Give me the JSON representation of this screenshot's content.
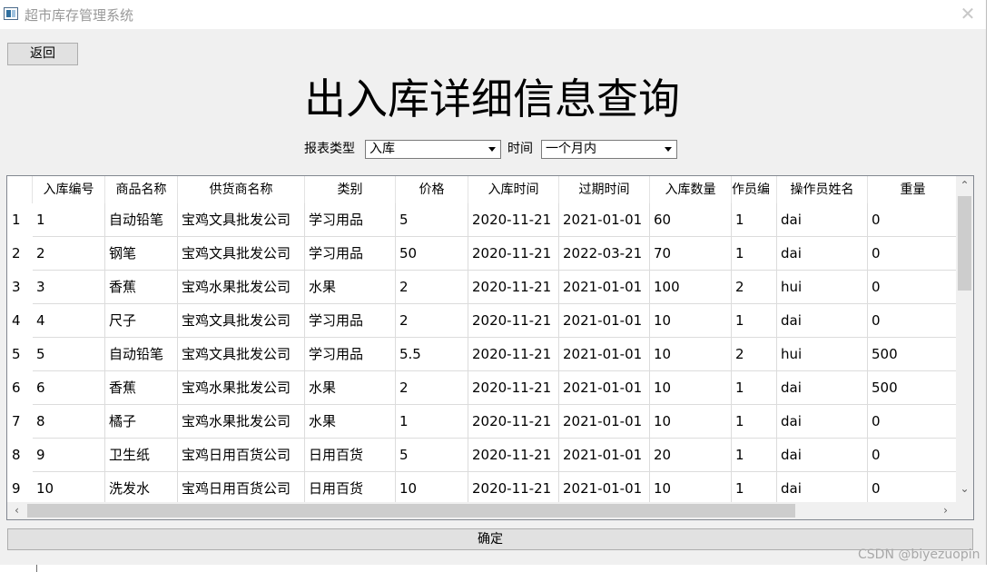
{
  "window": {
    "title": "超市库存管理系统",
    "close_glyph": "✕"
  },
  "back_label": "返回",
  "page_title": "出入库详细信息查询",
  "filters": {
    "report_type_label": "报表类型",
    "report_type_value": "入库",
    "time_label": "时间",
    "time_value": "一个月内"
  },
  "table": {
    "columns": [
      "入库编号",
      "商品名称",
      "供货商名称",
      "类别",
      "价格",
      "入库时间",
      "过期时间",
      "入库数量",
      "作员编",
      "操作员姓名",
      "重量"
    ],
    "rows": [
      [
        "1",
        "1",
        "自动铅笔",
        "宝鸡文具批发公司",
        "学习用品",
        "5",
        "2020-11-21",
        "2021-01-01",
        "60",
        "1",
        "dai",
        "0"
      ],
      [
        "2",
        "2",
        "钢笔",
        "宝鸡文具批发公司",
        "学习用品",
        "50",
        "2020-11-21",
        "2022-03-21",
        "70",
        "1",
        "dai",
        "0"
      ],
      [
        "3",
        "3",
        "香蕉",
        "宝鸡水果批发公司",
        "水果",
        "2",
        "2020-11-21",
        "2021-01-01",
        "100",
        "2",
        "hui",
        "0"
      ],
      [
        "4",
        "4",
        "尺子",
        "宝鸡文具批发公司",
        "学习用品",
        "2",
        "2020-11-21",
        "2021-01-01",
        "10",
        "1",
        "dai",
        "0"
      ],
      [
        "5",
        "5",
        "自动铅笔",
        "宝鸡文具批发公司",
        "学习用品",
        "5.5",
        "2020-11-21",
        "2021-01-01",
        "10",
        "2",
        "hui",
        "500"
      ],
      [
        "6",
        "6",
        "香蕉",
        "宝鸡水果批发公司",
        "水果",
        "2",
        "2020-11-21",
        "2021-01-01",
        "10",
        "1",
        "dai",
        "500"
      ],
      [
        "7",
        "8",
        "橘子",
        "宝鸡水果批发公司",
        "水果",
        "1",
        "2020-11-21",
        "2021-01-01",
        "10",
        "1",
        "dai",
        "0"
      ],
      [
        "8",
        "9",
        "卫生纸",
        "宝鸡日用百货公司",
        "日用百货",
        "5",
        "2020-11-21",
        "2021-01-01",
        "20",
        "1",
        "dai",
        "0"
      ],
      [
        "9",
        "10",
        "洗发水",
        "宝鸡日用百货公司",
        "日用百货",
        "10",
        "2020-11-21",
        "2021-01-01",
        "10",
        "1",
        "dai",
        "0"
      ]
    ]
  },
  "ok_label": "确定",
  "watermark": "CSDN @biyezuopin",
  "colors": {
    "window_bg": "#f0f0f0",
    "button_bg": "#e1e1e1",
    "grid_line": "#dcdcdc"
  }
}
